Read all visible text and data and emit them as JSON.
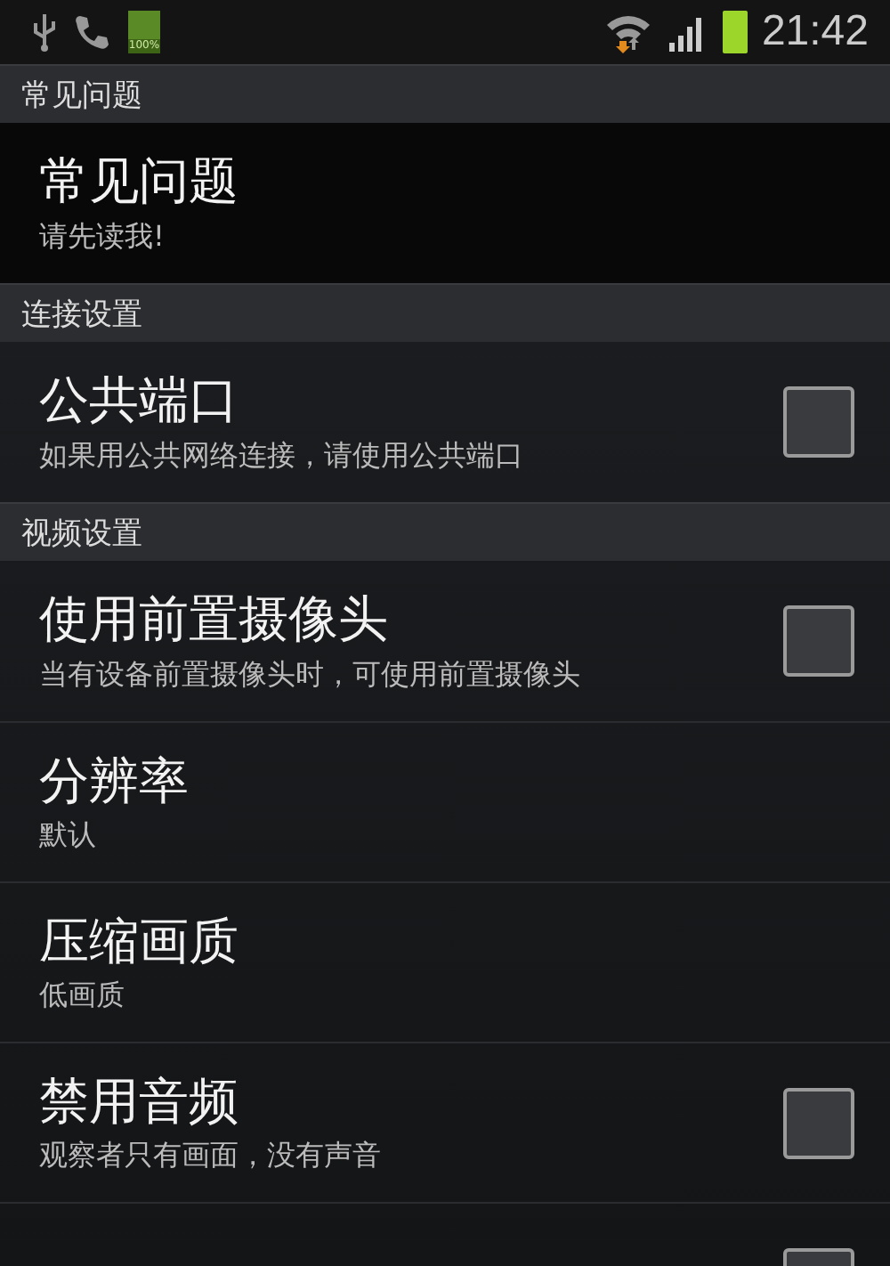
{
  "status_bar": {
    "battery_label": "100%",
    "time": "21:42"
  },
  "sections": [
    {
      "header": "常见问题",
      "items": [
        {
          "kind": "plain",
          "title": "常见问题",
          "subtitle": "请先读我!"
        }
      ]
    },
    {
      "header": "连接设置",
      "items": [
        {
          "kind": "checkbox",
          "title": "公共端口",
          "subtitle": "如果用公共网络连接，请使用公共端口",
          "checked": false
        }
      ]
    },
    {
      "header": "视频设置",
      "items": [
        {
          "kind": "checkbox",
          "title": "使用前置摄像头",
          "subtitle": "当有设备前置摄像头时，可使用前置摄像头",
          "checked": false
        },
        {
          "kind": "plain",
          "title": "分辨率",
          "subtitle": "默认"
        },
        {
          "kind": "plain",
          "title": "压缩画质",
          "subtitle": "低画质"
        },
        {
          "kind": "checkbox",
          "title": "禁用音频",
          "subtitle": "观察者只有画面，没有声音",
          "checked": false
        },
        {
          "kind": "checkbox",
          "checked": false
        }
      ]
    }
  ]
}
